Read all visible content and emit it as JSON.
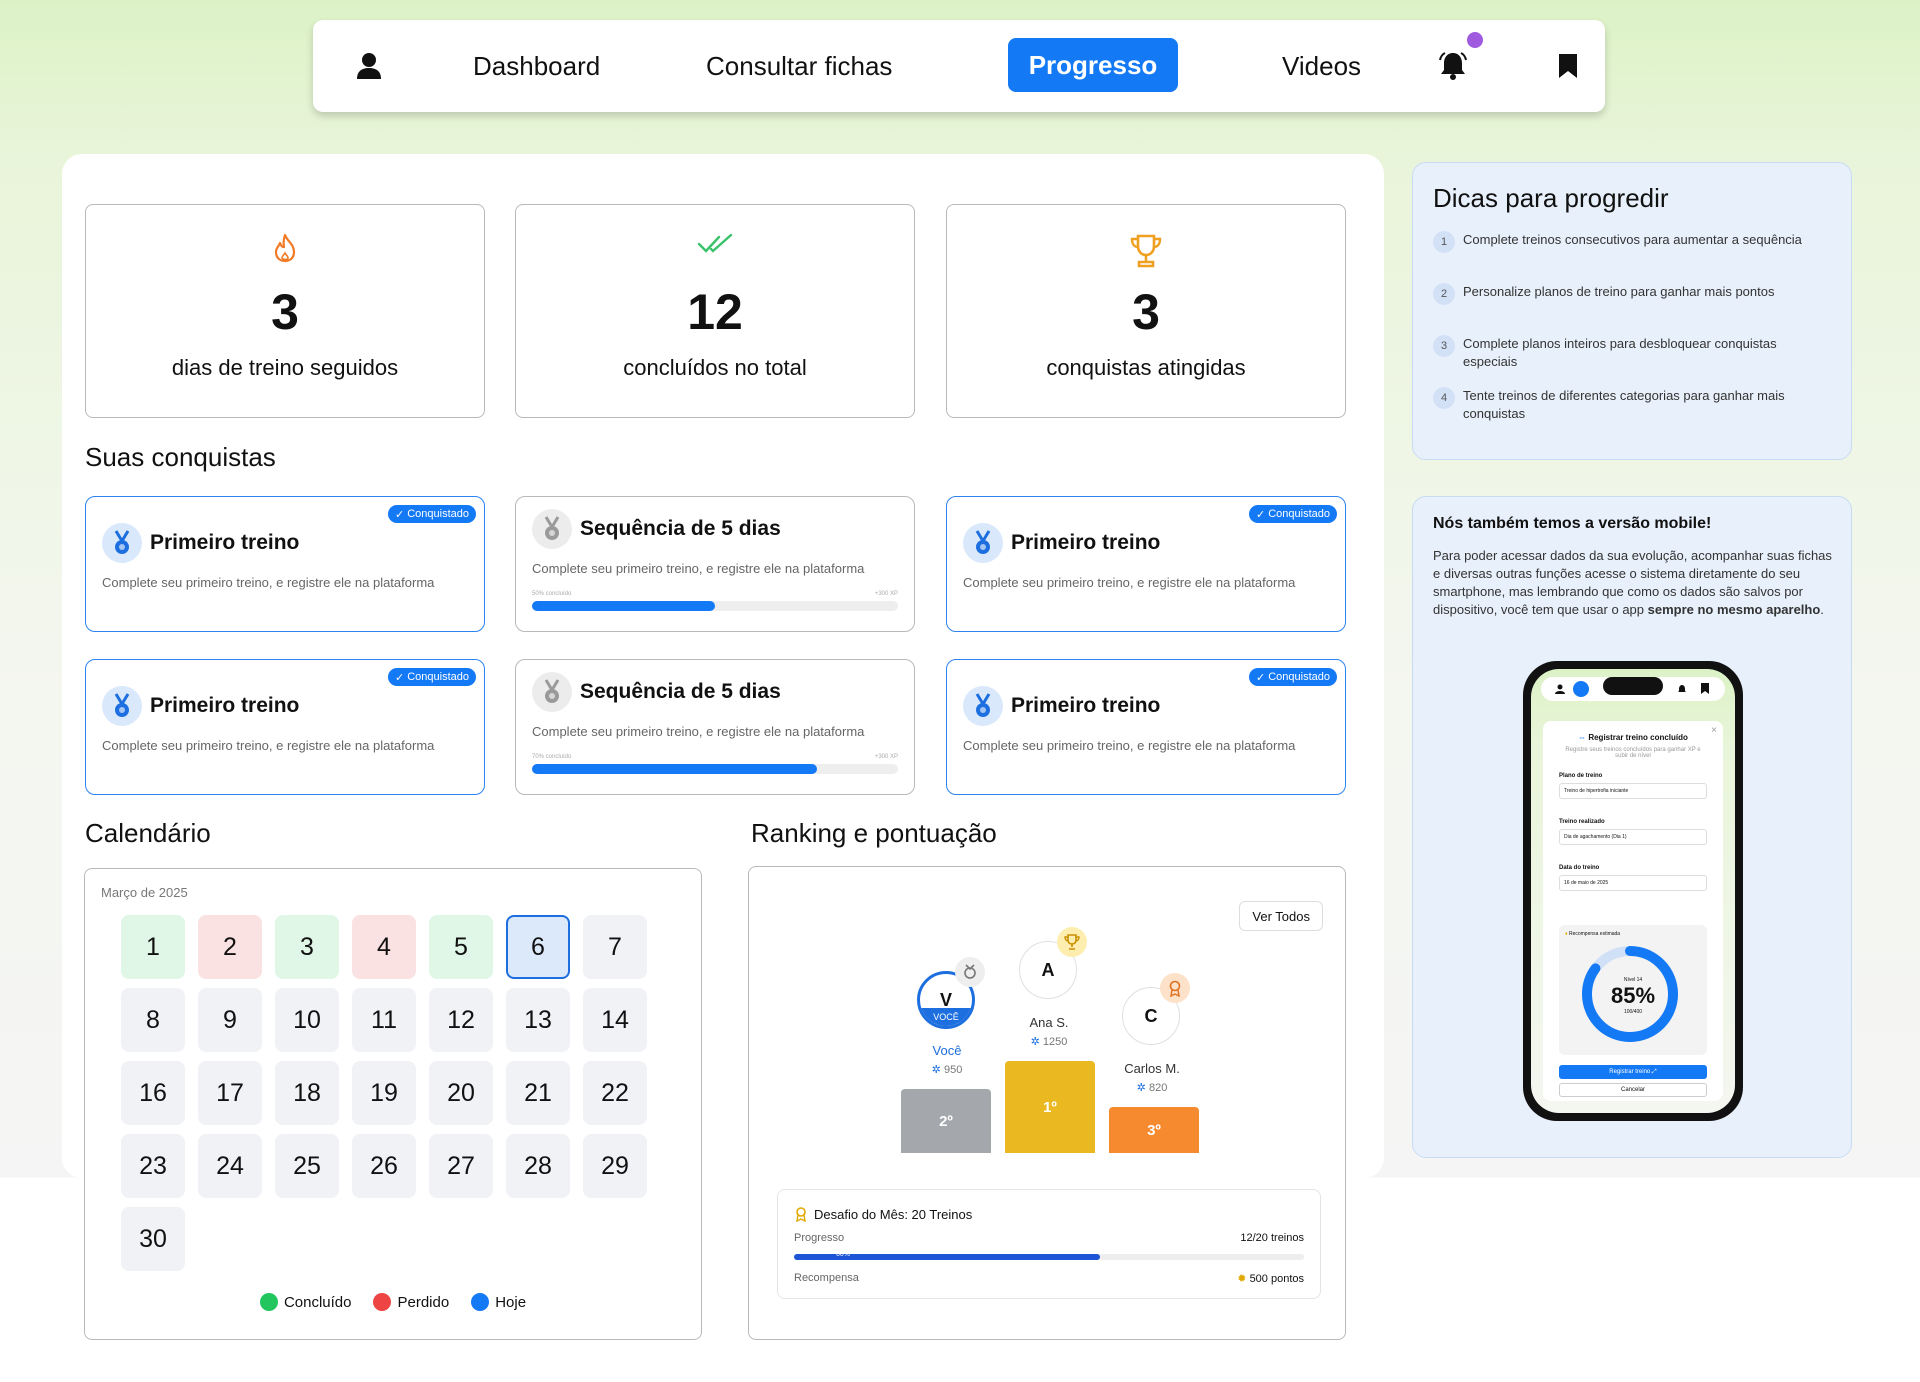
{
  "nav": {
    "dashboard": "Dashboard",
    "fichas": "Consultar fichas",
    "progresso": "Progresso",
    "videos": "Videos",
    "icons": [
      "user-icon",
      "bell-icon",
      "bookmark-icon"
    ]
  },
  "stats": [
    {
      "icon": "flame-icon",
      "value": "3",
      "label": "dias de treino seguidos"
    },
    {
      "icon": "double-check-icon",
      "value": "12",
      "label": "concluídos no total"
    },
    {
      "icon": "trophy-icon",
      "value": "3",
      "label": "conquistas atingidas"
    }
  ],
  "achievements": {
    "title": "Suas conquistas",
    "badge": "Conquistado",
    "items": [
      {
        "title": "Primeiro treino",
        "desc": "Complete seu primeiro treino, e registre ele na plataforma",
        "status": "done"
      },
      {
        "title": "Sequência de 5 dias",
        "desc": "Complete seu primeiro treino, e registre ele na plataforma",
        "status": "pending",
        "progress": 0.5,
        "meta_left": "50% concluído",
        "meta_right": "+300 XP"
      },
      {
        "title": "Primeiro treino",
        "desc": "Complete seu primeiro treino, e registre ele na plataforma",
        "status": "done"
      },
      {
        "title": "Primeiro treino",
        "desc": "Complete seu primeiro treino, e registre ele na plataforma",
        "status": "done"
      },
      {
        "title": "Sequência de 5 dias",
        "desc": "Complete seu primeiro treino, e registre ele na plataforma",
        "status": "pending",
        "progress": 0.78,
        "meta_left": "70% concluído",
        "meta_right": "+300 XP"
      },
      {
        "title": "Primeiro treino",
        "desc": "Complete seu primeiro treino, e registre ele na plataforma",
        "status": "done"
      }
    ]
  },
  "calendar": {
    "title": "Calendário",
    "month": "Março de 2025",
    "completed": [
      1,
      3,
      5
    ],
    "missed": [
      2,
      4
    ],
    "today": 6,
    "days": [
      "1",
      "2",
      "3",
      "4",
      "5",
      "6",
      "7",
      "8",
      "9",
      "10",
      "11",
      "12",
      "13",
      "14",
      "16",
      "17",
      "18",
      "19",
      "20",
      "21",
      "22",
      "23",
      "24",
      "25",
      "26",
      "27",
      "28",
      "29",
      "30"
    ],
    "legend": {
      "done": "Concluído",
      "missed": "Perdido",
      "today": "Hoje"
    },
    "colors": {
      "done": "#22c55e",
      "missed": "#ef4444",
      "today": "#1479f4"
    }
  },
  "ranking": {
    "title": "Ranking e pontuação",
    "see_all": "Ver Todos",
    "you_tag": "VOCÊ",
    "players": [
      {
        "initial": "V",
        "name": "Você",
        "points": "950",
        "place": "2º",
        "color": "#a4a7ab"
      },
      {
        "initial": "A",
        "name": "Ana S.",
        "points": "1250",
        "place": "1º",
        "color": "#eab921"
      },
      {
        "initial": "C",
        "name": "Carlos M.",
        "points": "820",
        "place": "3º",
        "color": "#f68a2f"
      }
    ],
    "challenge": {
      "title": "Desafio do Mês: 20 Treinos",
      "progress_label": "Progresso",
      "progress_value": "12/20 treinos",
      "progress": 0.6,
      "bar_text": "60%",
      "reward_label": "Recompensa",
      "reward_value": "500 pontos"
    }
  },
  "tips": {
    "title": "Dicas para progredir",
    "items": [
      "Complete treinos consecutivos para aumentar a sequência",
      "Personalize planos de treino para ganhar mais pontos",
      "Complete planos inteiros para desbloquear conquistas especiais",
      "Tente treinos de diferentes categorias para ganhar mais conquistas"
    ]
  },
  "mobile": {
    "title": "Nós também temos a versão mobile!",
    "text": "Para poder acessar dados da sua evolução, acompanhar suas fichas e diversas outras funções acesse o sistema diretamente do seu smartphone, mas lembrando que como os dados são salvos por dispositivo, você tem que usar o app ",
    "text_bold": "sempre no mesmo aparelho",
    "text_end": ".",
    "phone": {
      "modal_title": "Registrar treino concluído",
      "modal_sub": "Registre seus treinos concluídos para ganhar XP e subir de nível",
      "plan_label": "Plano de treino",
      "plan_value": "Treino de hipertrofia iniciante",
      "done_label": "Treino realizado",
      "done_value": "Dia de agachamento (Dia 1)",
      "date_label": "Data do treino",
      "date_value": "16 de maio de 2025",
      "reward_label": "Recompensa estimada",
      "level": "Nível 14",
      "percent": "85%",
      "xp": "100/400",
      "level_progress": 0.85,
      "submit": "Registrar treino",
      "cancel": "Cancelar"
    }
  }
}
